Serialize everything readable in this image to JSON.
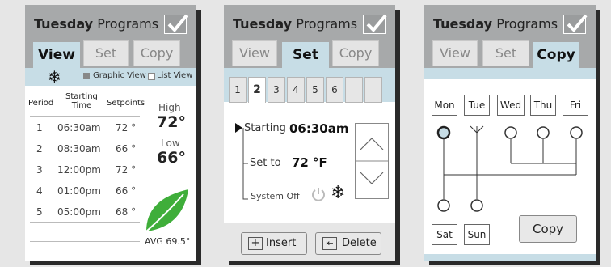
{
  "panel_view": {
    "title_bold": "Tuesday",
    "title_rest": " Programs",
    "tabs": [
      "View",
      "Set",
      "Copy"
    ],
    "graphic_view_label": "Graphic View",
    "list_view_label": "List View",
    "col_period": "Period",
    "col_start_1": "Starting",
    "col_start_2": "Time",
    "col_setpoints": "Setpoints",
    "rows": [
      {
        "period": "1",
        "time": "06:30am",
        "set": "72 °"
      },
      {
        "period": "2",
        "time": "08:30am",
        "set": "66 °"
      },
      {
        "period": "3",
        "time": "12:00pm",
        "set": "72 °"
      },
      {
        "period": "4",
        "time": "01:00pm",
        "set": "66 °"
      },
      {
        "period": "5",
        "time": "05:00pm",
        "set": "68 °"
      }
    ],
    "high_label": "High",
    "high_value": "72°",
    "low_label": "Low",
    "low_value": "66°",
    "avg": "AVG 69.5°"
  },
  "panel_set": {
    "title_bold": "Tuesday",
    "title_rest": " Programs",
    "tabs": [
      "View",
      "Set",
      "Copy"
    ],
    "period_tabs": [
      "1",
      "2",
      "3",
      "4",
      "5",
      "6",
      "",
      ""
    ],
    "starting_label": "Starting",
    "starting_value": "06:30am",
    "setto_label": "Set to",
    "setto_value": "72",
    "setto_unit": "°F",
    "system_label": "System Off",
    "insert_label": "Insert",
    "delete_label": "Delete"
  },
  "panel_copy": {
    "title_bold": "Tuesday",
    "title_rest": " Programs",
    "tabs": [
      "View",
      "Set",
      "Copy"
    ],
    "weekdays": [
      "Mon",
      "Tue",
      "Wed",
      "Thu",
      "Fri"
    ],
    "weekend": [
      "Sat",
      "Sun"
    ],
    "copy_label": "Copy"
  },
  "colors": {
    "header": "#a7a9aa",
    "accent": "#c7dde6",
    "leaf": "#3fae3a"
  }
}
